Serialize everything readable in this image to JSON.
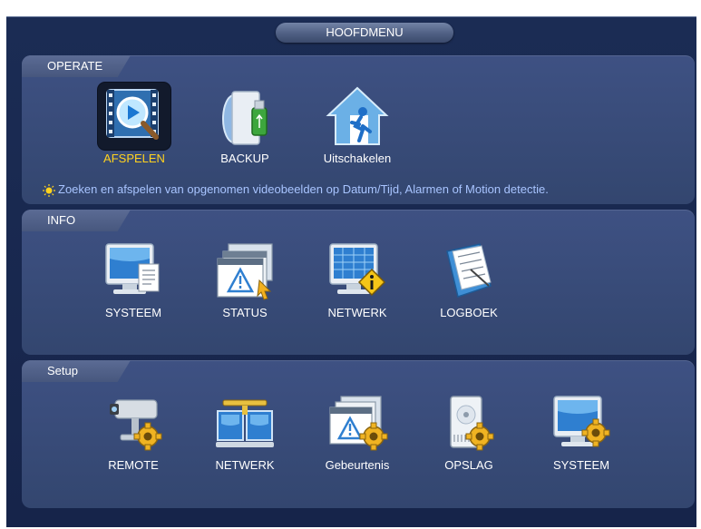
{
  "title": "HOOFDMENU",
  "sections": {
    "operate": {
      "label": "OPERATE",
      "items": [
        {
          "label": "AFSPELEN",
          "icon": "video-play-search-icon",
          "selected": true
        },
        {
          "label": "BACKUP",
          "icon": "disc-usb-backup-icon"
        },
        {
          "label": "Uitschakelen",
          "icon": "exit-house-icon"
        }
      ],
      "hint": "Zoeken en afspelen van opgenomen videobeelden op Datum/Tijd, Alarmen of Motion detectie."
    },
    "info": {
      "label": "INFO",
      "items": [
        {
          "label": "SYSTEEM",
          "icon": "monitor-document-icon"
        },
        {
          "label": "STATUS",
          "icon": "status-warning-windows-icon"
        },
        {
          "label": "NETWERK",
          "icon": "monitor-info-icon"
        },
        {
          "label": "LOGBOEK",
          "icon": "logbook-icon"
        }
      ]
    },
    "setup": {
      "label": "Setup",
      "items": [
        {
          "label": "REMOTE",
          "icon": "camera-gear-icon"
        },
        {
          "label": "NETWERK",
          "icon": "network-gear-icon"
        },
        {
          "label": "Gebeurtenis",
          "icon": "event-warning-gear-icon"
        },
        {
          "label": "OPSLAG",
          "icon": "storage-disk-gear-icon"
        },
        {
          "label": "SYSTEEM",
          "icon": "monitor-gear-icon"
        }
      ]
    }
  },
  "colors": {
    "background": "#1b2c54",
    "panel": "#3e5183",
    "selected_label": "#ffd21e",
    "hint_text": "#a8c4ff"
  }
}
